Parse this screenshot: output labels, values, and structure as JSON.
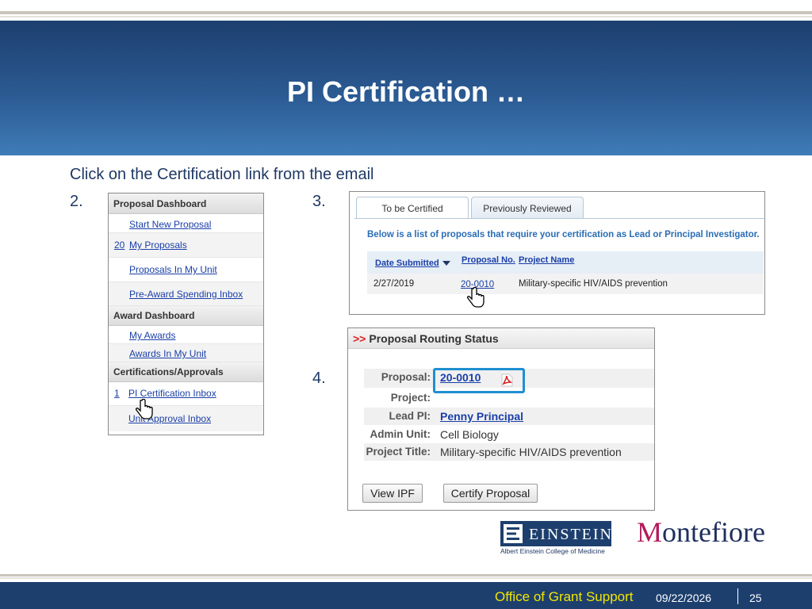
{
  "slide": {
    "title": "PI Certification …",
    "intro": "Click on the Certification link from the email",
    "steps": [
      "2.",
      "3.",
      "4."
    ]
  },
  "sidebar": {
    "sections": [
      {
        "heading": "Proposal Dashboard",
        "items": [
          {
            "count": "",
            "label": "Start New Proposal"
          },
          {
            "count": "20",
            "label": "My Proposals"
          },
          {
            "count": "",
            "label": "Proposals In My Unit"
          },
          {
            "count": "",
            "label": "Pre-Award Spending Inbox"
          }
        ]
      },
      {
        "heading": "Award Dashboard",
        "items": [
          {
            "count": "",
            "label": "My Awards"
          },
          {
            "count": "",
            "label": "Awards In My Unit"
          }
        ]
      },
      {
        "heading": "Certifications/Approvals",
        "items": [
          {
            "count": "1",
            "label": "PI Certification Inbox"
          },
          {
            "count": "",
            "label": "Unit Approval Inbox"
          }
        ]
      }
    ]
  },
  "certification": {
    "tabs": [
      "To be Certified",
      "Previously Reviewed"
    ],
    "description": "Below is a list of proposals that require your certification as Lead or Principal Investigator.",
    "columns": [
      "Date Submitted",
      "Proposal No.",
      "Project Name"
    ],
    "rows": [
      {
        "date": "2/27/2019",
        "proposal_no": "20-0010",
        "project": "Military-specific HIV/AIDS prevention"
      }
    ]
  },
  "routing": {
    "heading": "Proposal Routing Status",
    "arrow": ">>",
    "fields": [
      {
        "label": "Proposal:",
        "value": "20-0010"
      },
      {
        "label": "Project:",
        "value": ""
      },
      {
        "label": "Lead PI:",
        "value": "Penny Principal"
      },
      {
        "label": "Admin Unit:",
        "value": "Cell Biology"
      },
      {
        "label": "Project Title:",
        "value": "Military-specific HIV/AIDS prevention"
      }
    ],
    "buttons": [
      "View IPF",
      "Certify Proposal"
    ]
  },
  "logos": {
    "einstein": "EINSTEIN",
    "einstein_sub": "Albert Einstein College of Medicine",
    "montefiore_initial": "M",
    "montefiore_rest": "ontefiore"
  },
  "footer": {
    "office": "Office of Grant Support",
    "date": "09/22/2026",
    "page": "25"
  },
  "colors": {
    "banner": "#1d3f6e",
    "link": "#1a3fa8",
    "highlight": "#1f8fd0",
    "footer_office": "#f2e500"
  }
}
